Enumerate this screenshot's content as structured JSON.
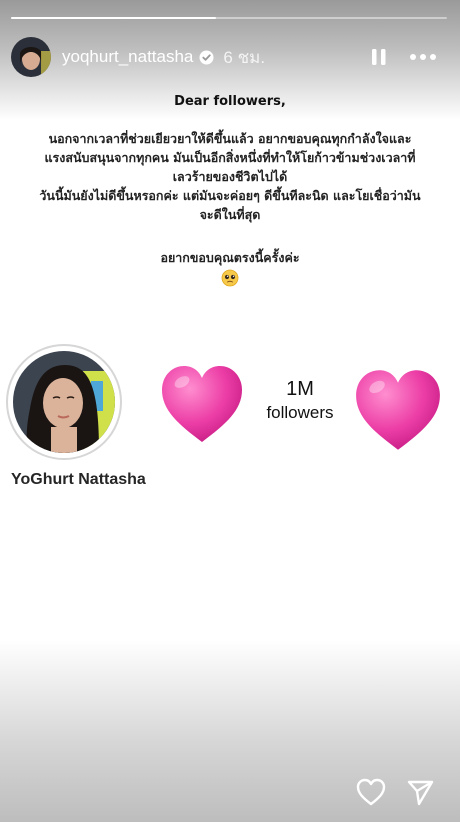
{
  "story": {
    "progress": 0.47
  },
  "header": {
    "username": "yoqhurt_nattasha",
    "time_ago": "6 ชม.",
    "verified_icon": "verified-badge-icon",
    "pause_icon": "pause-icon",
    "more_icon": "more-options-icon"
  },
  "letter": {
    "title": "Dear followers,",
    "body_lines": [
      "นอกจากเวลาที่ช่วยเยียวยาให้ดีขึ้นแล้ว อยากขอบคุณทุกกำลังใจและ",
      "แรงสนับสนุนจากทุกคน มันเป็นอีกสิ่งหนึ่งที่ทำให้โยก้าวข้ามช่วงเวลาที่",
      "เลวร้ายของชีวิตไปได้",
      "วันนี้มันยังไม่ดีขึ้นหรอกค่ะ แต่มันจะค่อยๆ ดีขึ้นทีละนิด และโยเชื่อว่ามัน",
      "จะดีในที่สุด"
    ],
    "thanks": "อยากขอบคุณตรงนี้ครั้งค่ะ",
    "emoji": "🥺"
  },
  "profile_card": {
    "name": "YoGhurt Nattasha",
    "follower_count": "1M",
    "follower_label": "followers",
    "heart_color": "#ec3ea6"
  },
  "footer": {
    "like_icon": "heart-outline-icon",
    "share_icon": "send-icon"
  }
}
